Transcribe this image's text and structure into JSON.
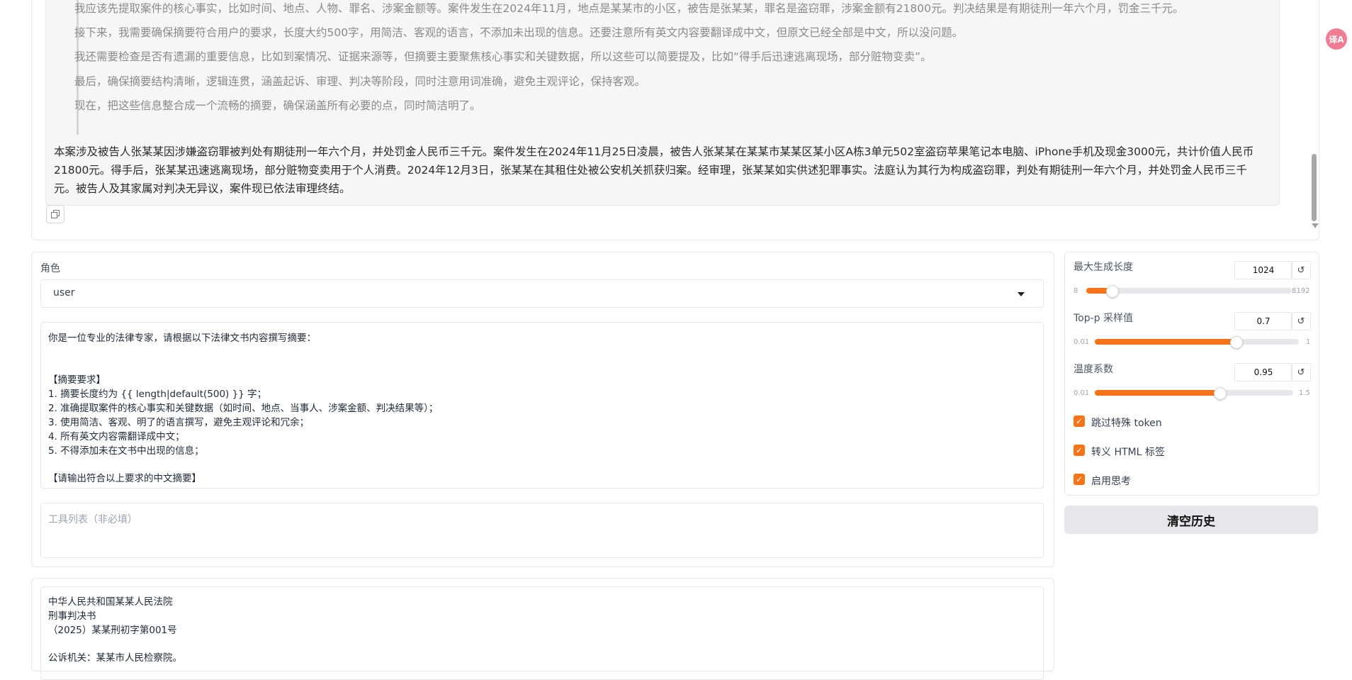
{
  "chat": {
    "thinking_lines": [
      "我应该先提取案件的核心事实，比如时间、地点、人物、罪名、涉案金额等。案件发生在2024年11月，地点是某某市的小区，被告是张某某，罪名是盗窃罪，涉案金额有21800元。判决结果是有期徒刑一年六个月，罚金三千元。",
      "接下来，我需要确保摘要符合用户的要求，长度大约500字，用简洁、客观的语言，不添加未出现的信息。还要注意所有英文内容要翻译成中文，但原文已经全部是中文，所以没问题。",
      "我还需要检查是否有遗漏的重要信息，比如到案情况、证据来源等，但摘要主要聚焦核心事实和关键数据，所以这些可以简要提及，比如“得手后迅速逃离现场，部分赃物变卖”。",
      "最后，确保摘要结构清晰，逻辑连贯，涵盖起诉、审理、判决等阶段，同时注意用词准确，避免主观评论，保持客观。",
      "现在，把这些信息整合成一个流畅的摘要，确保涵盖所有必要的点，同时简洁明了。"
    ],
    "answer": "本案涉及被告人张某某因涉嫌盗窃罪被判处有期徒刑一年六个月，并处罚金人民币三千元。案件发生在2024年11月25日凌晨，被告人张某某在某某市某某区某小区A栋3单元502室盗窃苹果笔记本电脑、iPhone手机及现金3000元，共计价值人民币21800元。得手后，张某某迅速逃离现场，部分赃物变卖用于个人消费。2024年12月3日，张某某在其租住处被公安机关抓获归案。经审理，张某某如实供述犯罪事实。法庭认为其行为构成盗窃罪，判处有期徒刑一年六个月，并处罚金人民币三千元。被告人及其家属对判决无异议，案件现已依法审理终结。"
  },
  "role": {
    "label": "角色",
    "value": "user"
  },
  "system_prompt": {
    "lines": [
      "你是一位专业的法律专家，请根据以下法律文书内容撰写摘要：",
      "",
      "",
      "【摘要要求】",
      "1. 摘要长度约为 {{ length|default(500) }} 字；",
      "2. 准确提取案件的核心事实和关键数据（如时间、地点、当事人、涉案金额、判决结果等）；",
      "3. 使用简洁、客观、明了的语言撰写，避免主观评论和冗余；",
      "4. 所有英文内容需翻译成中文；",
      "5. 不得添加未在文书中出现的信息；",
      "",
      "【请输出符合以上要求的中文摘要】"
    ]
  },
  "tools": {
    "placeholder": "工具列表（非必填）"
  },
  "document": {
    "lines": [
      "中华人民共和国某某人民法院",
      "刑事判决书",
      "（2025）某某刑初字第001号",
      "",
      "公诉机关：某某市人民检察院。"
    ]
  },
  "settings": {
    "sliders": [
      {
        "label": "最大生成长度",
        "value": "1024",
        "min": "8",
        "max": "8192",
        "fraction": 0.124
      },
      {
        "label": "Top-p 采样值",
        "value": "0.7",
        "min": "0.01",
        "max": "1",
        "fraction": 0.69
      },
      {
        "label": "温度系数",
        "value": "0.95",
        "min": "0.01",
        "max": "1.5",
        "fraction": 0.63
      }
    ],
    "checkboxes": [
      {
        "label": "跳过特殊 token",
        "checked": true
      },
      {
        "label": "转义 HTML 标签",
        "checked": true
      },
      {
        "label": "启用思考",
        "checked": true
      }
    ],
    "reset_glyph": "↺",
    "check_glyph": "✓"
  },
  "clear_button": "清空历史",
  "translate_badge": "译A",
  "colors": {
    "accent": "#f97316",
    "panel_border": "#e5e7eb",
    "bubble_bg": "#f6f6f6"
  }
}
